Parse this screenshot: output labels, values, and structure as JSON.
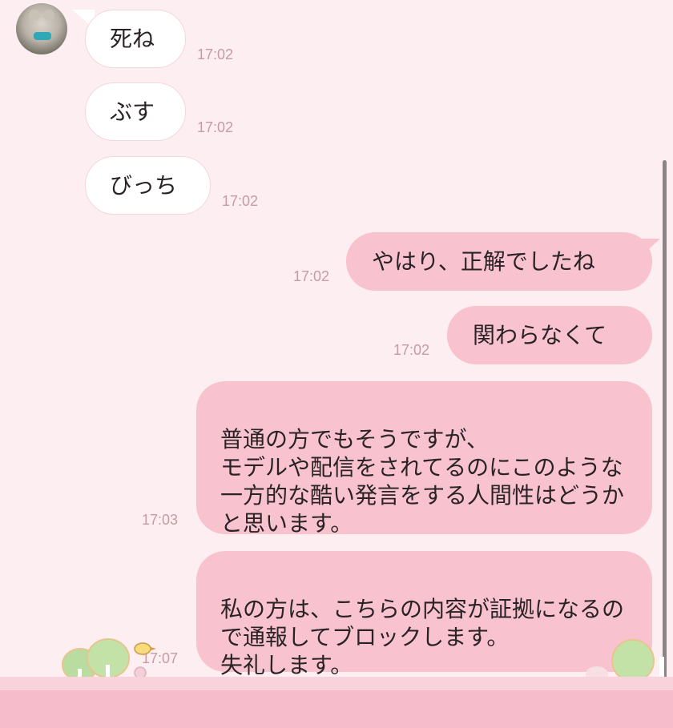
{
  "incoming": [
    {
      "text": "死ね",
      "time": "17:02"
    },
    {
      "text": "ぶす",
      "time": "17:02"
    },
    {
      "text": "びっち",
      "time": "17:02"
    }
  ],
  "outgoing": [
    {
      "text": "やはり、正解でしたね",
      "time": "17:02"
    },
    {
      "text": "関わらなくて",
      "time": "17:02"
    },
    {
      "text": "普通の方でもそうですが、\nモデルや配信をされてるのにこのような一方的な酷い発言をする人間性はどうかと思います。",
      "time": "17:03"
    },
    {
      "text": "私の方は、こちらの内容が証拠になるので通報してブロックします。\n失礼します。",
      "time": "17:07"
    }
  ],
  "colors": {
    "background": "#fdeef1",
    "incoming_bubble": "#ffffff",
    "outgoing_bubble": "#f8c3cf",
    "timestamp": "#c79aa4",
    "bottom_bar": "#f6bccb"
  },
  "icons": {
    "avatar": "teddy-bear-avatar",
    "decoration": "trees-and-bird-illustration"
  }
}
